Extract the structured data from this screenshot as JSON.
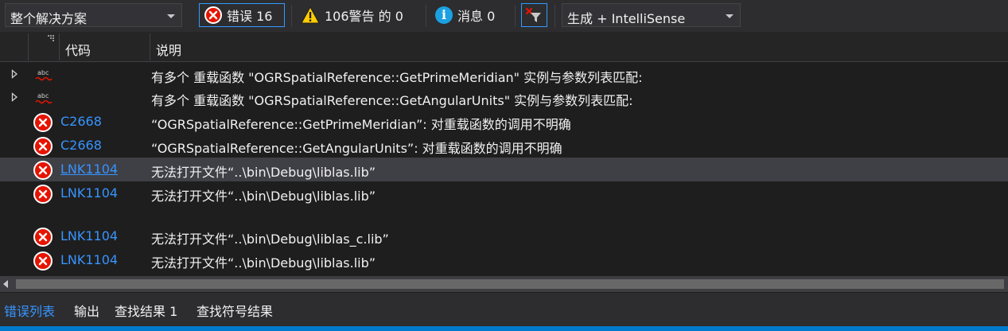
{
  "toolbar": {
    "scope_value": "整个解决方案",
    "errors_label": "错误 16",
    "warnings_label": "106警告 的 0",
    "messages_label": "消息 0",
    "build_source_value": "生成 + IntelliSense"
  },
  "columns": {
    "code": "代码",
    "description": "说明"
  },
  "rows": [
    {
      "type": "intellisense",
      "expandable": true,
      "code": "",
      "description": "有多个 重载函数 \"OGRSpatialReference::GetPrimeMeridian\" 实例与参数列表匹配:"
    },
    {
      "type": "intellisense",
      "expandable": true,
      "code": "",
      "description": "有多个 重载函数 \"OGRSpatialReference::GetAngularUnits\" 实例与参数列表匹配:"
    },
    {
      "type": "error",
      "expandable": false,
      "code": "C2668",
      "description": "“OGRSpatialReference::GetPrimeMeridian”: 对重载函数的调用不明确"
    },
    {
      "type": "error",
      "expandable": false,
      "code": "C2668",
      "description": "“OGRSpatialReference::GetAngularUnits”: 对重载函数的调用不明确"
    },
    {
      "type": "error",
      "expandable": false,
      "code": "LNK1104",
      "description": "无法打开文件“..\\bin\\Debug\\liblas.lib”",
      "selected": true
    },
    {
      "type": "error",
      "expandable": false,
      "code": "LNK1104",
      "description": "无法打开文件“..\\bin\\Debug\\liblas.lib”"
    },
    {
      "type": "error",
      "expandable": false,
      "code": "LNK1104",
      "description": "无法打开文件“..\\bin\\Debug\\liblas_c.lib”"
    },
    {
      "type": "error",
      "expandable": false,
      "code": "LNK1104",
      "description": "无法打开文件“..\\bin\\Debug\\liblas.lib”"
    }
  ],
  "bottom_tabs": [
    {
      "label": "错误列表",
      "active": true
    },
    {
      "label": "输出",
      "active": false
    },
    {
      "label": "查找结果 1",
      "active": false
    },
    {
      "label": "查找符号结果",
      "active": false
    }
  ],
  "colors": {
    "background": "#1e1e1e",
    "error_red": "#e51400",
    "link_blue": "#3794ff",
    "accent": "#007acc"
  }
}
